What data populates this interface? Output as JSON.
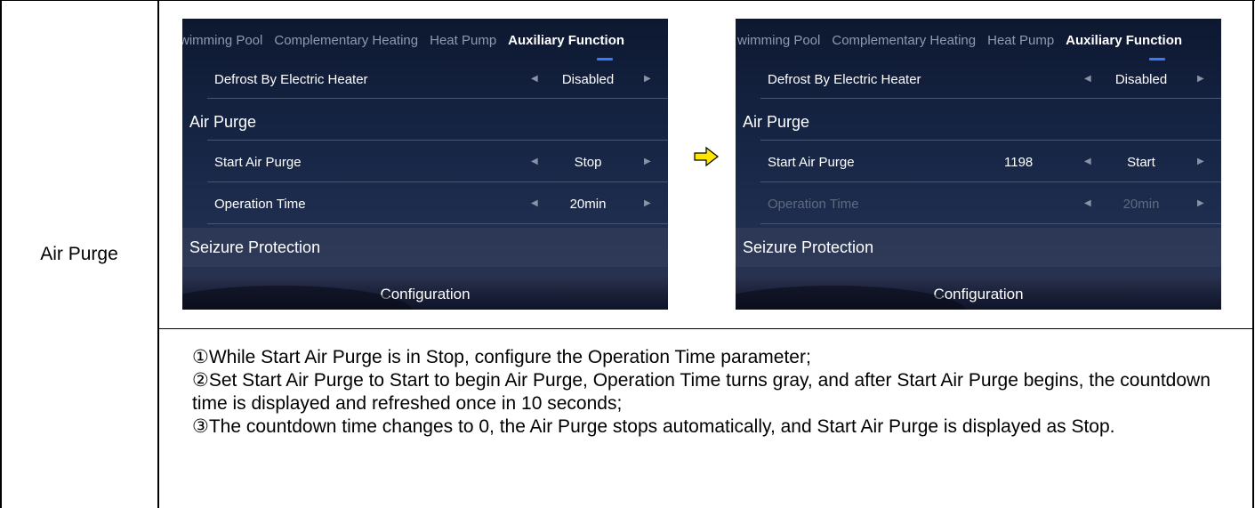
{
  "row_label": "Air Purge",
  "screen_left": {
    "tabs": [
      "wimming Pool",
      "Complementary Heating",
      "Heat Pump",
      "Auxiliary Function"
    ],
    "rows": {
      "defrost": {
        "label": "Defrost By Electric Heater",
        "value": "Disabled"
      },
      "section_air_purge": "Air Purge",
      "start": {
        "label": "Start Air Purge",
        "value": "Stop"
      },
      "op_time": {
        "label": "Operation Time",
        "value": "20min"
      },
      "section_seizure": "Seizure Protection"
    },
    "footer": "Configuration"
  },
  "screen_right": {
    "tabs": [
      "wimming Pool",
      "Complementary Heating",
      "Heat Pump",
      "Auxiliary Function"
    ],
    "rows": {
      "defrost": {
        "label": "Defrost By Electric Heater",
        "value": "Disabled"
      },
      "section_air_purge": "Air Purge",
      "start": {
        "label": "Start Air Purge",
        "countdown": "1198",
        "value": "Start"
      },
      "op_time": {
        "label": "Operation Time",
        "value": "20min"
      },
      "section_seizure": "Seizure Protection"
    },
    "footer": "Configuration"
  },
  "notes": [
    "①While Start Air Purge is in Stop, configure the Operation Time parameter;",
    "②Set Start Air Purge to Start to begin Air Purge, Operation Time turns gray, and after Start Air Purge begins, the countdown time is displayed and refreshed once in 10 seconds;",
    "③The countdown time changes to 0, the Air Purge stops automatically, and Start Air Purge  is displayed as Stop."
  ],
  "colors": {
    "accent_blue": "#3a78ff",
    "arrow_yellow": "#ffe600",
    "screen_bg": "#152342"
  }
}
